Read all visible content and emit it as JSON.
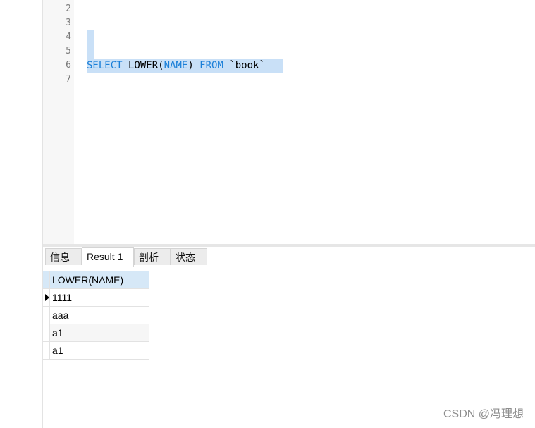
{
  "editor": {
    "line_numbers": [
      "2",
      "3",
      "4",
      "5",
      "6",
      "7"
    ],
    "code": {
      "keyword_select": "SELECT",
      "func_lower": " LOWER(",
      "arg_name": "NAME",
      "close_paren": ") ",
      "keyword_from": "FROM",
      "table_ref": " `book`"
    },
    "top_fragment": "(   )"
  },
  "tabs": [
    {
      "label": "信息"
    },
    {
      "label": "Result 1"
    },
    {
      "label": "剖析"
    },
    {
      "label": "状态"
    }
  ],
  "result": {
    "column": "LOWER(NAME)",
    "rows": [
      "1111",
      "aaa",
      "a1",
      "a1"
    ]
  },
  "watermark": "CSDN @冯理想",
  "colors": {
    "keyword": "#1a7fd8",
    "selection": "#c9e0f7",
    "header": "#d6e8f7"
  }
}
